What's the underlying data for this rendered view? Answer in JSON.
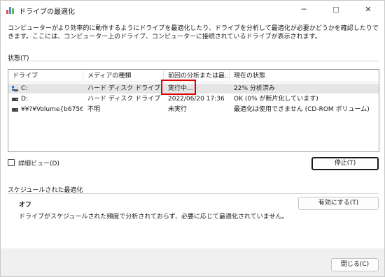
{
  "window": {
    "title": "ドライブの最適化"
  },
  "description": "コンピューターがより効率的に動作するようにドライブを最適化したり、ドライブを分析して最適化が必要かどうかを確認したりできます。ここには、コンピューター上のドライブ、コンピューターに接続されているドライブが表示されます。",
  "status_section": {
    "label": "状態(T)"
  },
  "drive_list": {
    "columns": [
      "ドライブ",
      "メディアの種類",
      "前回の分析または最...",
      "現在の状態"
    ],
    "rows": [
      {
        "drive": "C:",
        "media": "ハード ディスク ドライブ",
        "last": "実行中...",
        "status": "22% 分析済み",
        "icon": "system-drive-icon"
      },
      {
        "drive": "D:",
        "media": "ハード ディスク ドライブ",
        "last": "2022/06/20 17:36",
        "status": "OK (0% が断片化しています)",
        "icon": "hard-drive-icon"
      },
      {
        "drive": "¥¥?¥Volume{b6756f...",
        "media": "不明",
        "last": "未実行",
        "status": "最適化は使用できません (CD-ROM ボリューム)",
        "icon": "volume-drive-icon"
      }
    ]
  },
  "detail_view": {
    "label": "詳細ビュー(D)",
    "checked": false
  },
  "stop_button": "停止(T)",
  "schedule": {
    "label": "スケジュールされた最適化",
    "status": "オフ",
    "description": "ドライブがスケジュールされた頻度で分析されておらず、必要に応じて最適化されていません。",
    "enable_button": "有効にする(T)"
  },
  "close_button": "閉じる(C)",
  "colors": {
    "highlight": "#e00000",
    "selection": "#e5e5e5"
  }
}
